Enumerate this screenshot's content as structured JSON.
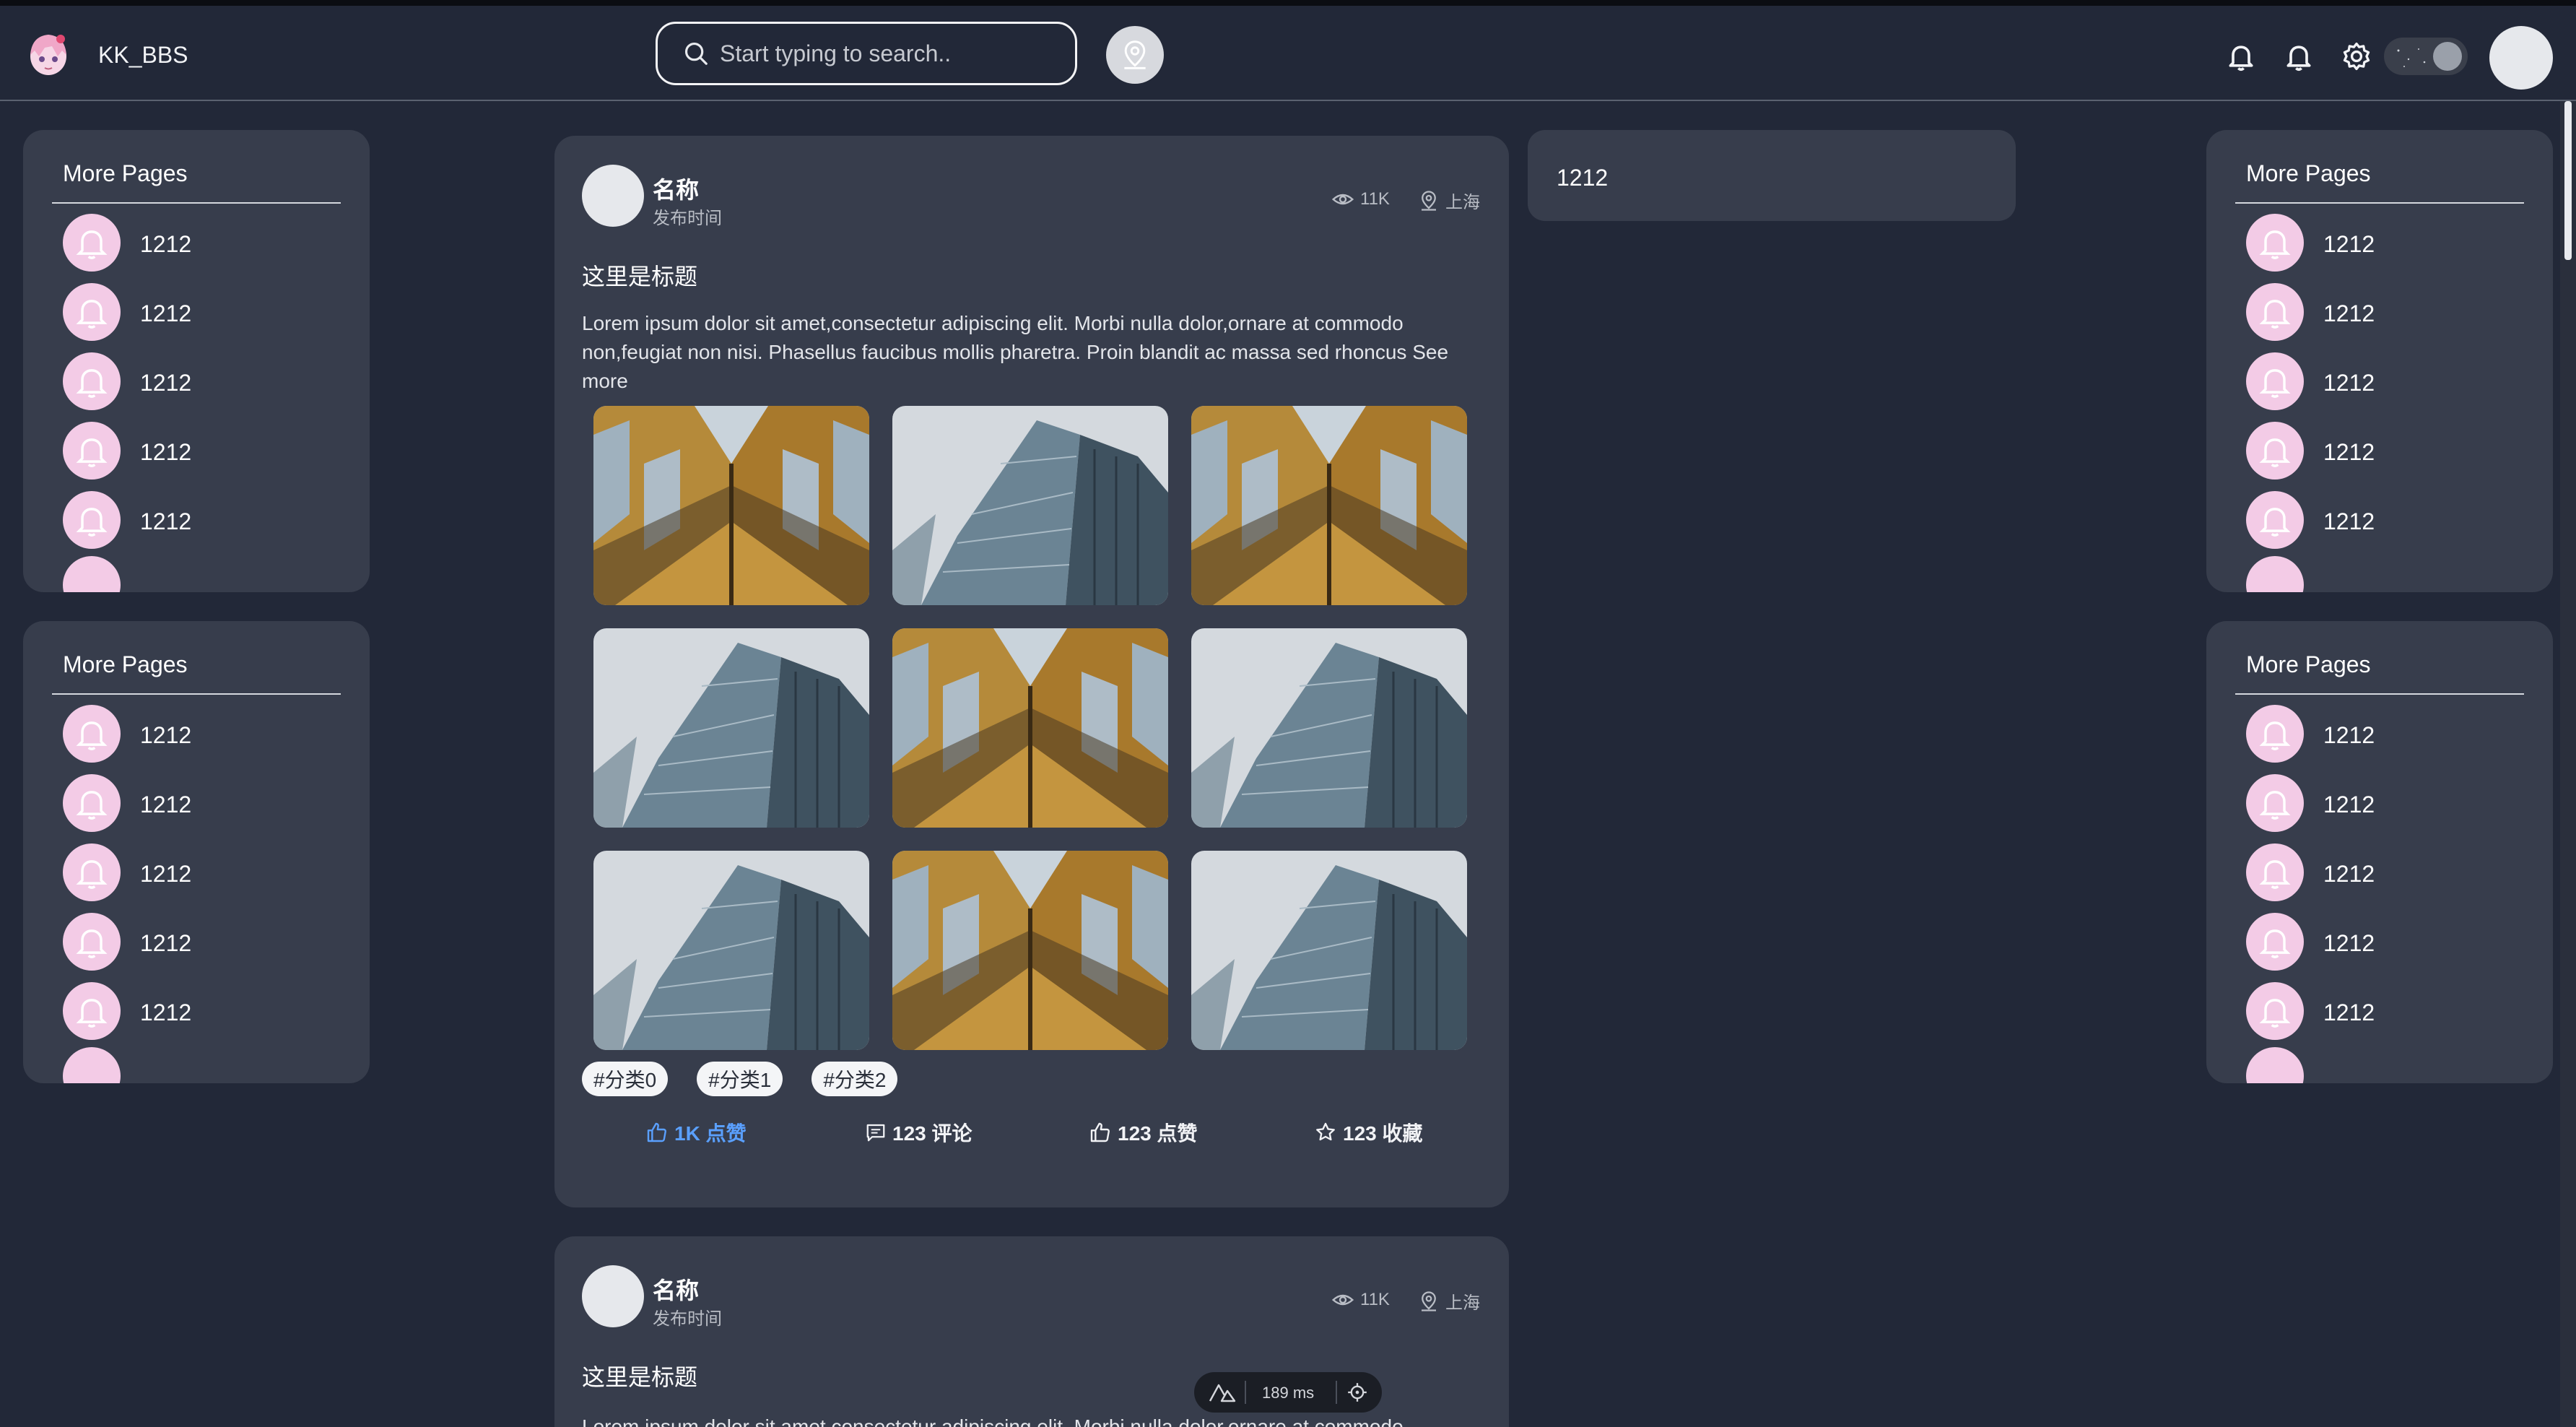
{
  "header": {
    "app_title": "KK_BBS",
    "search_placeholder": "Start typing to search..",
    "icons": [
      "bell-icon",
      "bell-icon",
      "gear-icon",
      "theme-toggle",
      "user-avatar"
    ]
  },
  "left_panels": [
    {
      "title": "More Pages",
      "items": [
        "1212",
        "1212",
        "1212",
        "1212",
        "1212"
      ]
    },
    {
      "title": "More Pages",
      "items": [
        "1212",
        "1212",
        "1212",
        "1212",
        "1212"
      ]
    }
  ],
  "right_panels": [
    {
      "title": "More Pages",
      "items": [
        "1212",
        "1212",
        "1212",
        "1212",
        "1212"
      ]
    },
    {
      "title": "More Pages",
      "items": [
        "1212",
        "1212",
        "1212",
        "1212",
        "1212"
      ]
    }
  ],
  "mini_card": {
    "text": "1212"
  },
  "posts": [
    {
      "name": "名称",
      "time": "发布时间",
      "views": "11K",
      "location": "上海",
      "title": "这里是标题",
      "body": "Lorem ipsum dolor sit amet,consectetur adipiscing elit. Morbi nulla dolor,ornare at commodo non,feugiat non nisi. Phasellus faucibus mollis pharetra. Proin blandit ac massa sed rhoncus See more",
      "images": [
        "gold-building",
        "glass-building",
        "gold-building",
        "glass-building",
        "gold-building",
        "glass-building",
        "glass-building",
        "gold-building",
        "glass-building"
      ],
      "tags": [
        "#分类0",
        "#分类1",
        "#分类2"
      ],
      "actions": {
        "like": "1K 点赞",
        "comment": "123 评论",
        "thumb": "123 点赞",
        "favorite": "123 收藏"
      }
    },
    {
      "name": "名称",
      "time": "发布时间",
      "views": "11K",
      "location": "上海",
      "title": "这里是标题",
      "body": "Lorem ipsum dolor sit amet,consectetur adipiscing elit. Morbi nulla dolor,ornare at commodo"
    }
  ],
  "devtools": {
    "timing": "189 ms"
  },
  "colors": {
    "background": "#222838",
    "card": "#373d4c",
    "accent": "#5aa0ff",
    "bubble": "#f3cbe6"
  }
}
